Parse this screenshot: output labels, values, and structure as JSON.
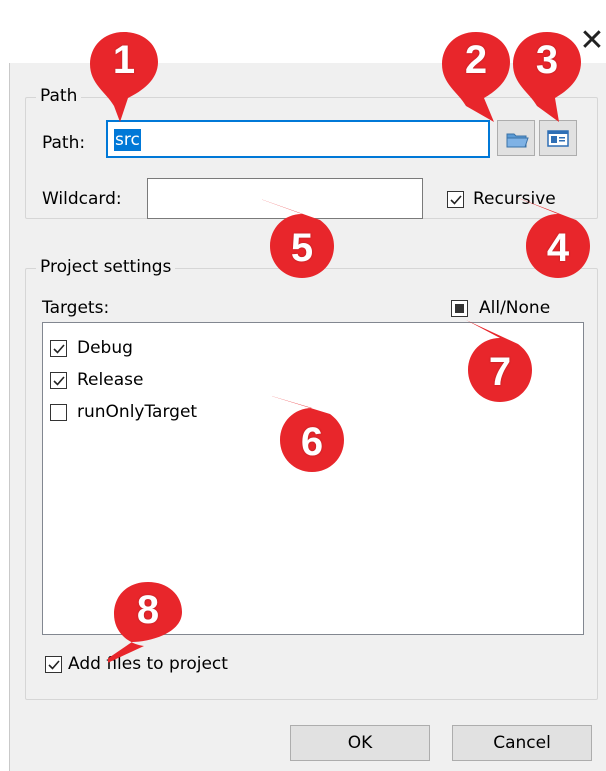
{
  "window": {
    "close_glyph": "✕"
  },
  "path_group": {
    "title": "Path",
    "path_label": "Path:",
    "path_value": "src",
    "wildcard_label": "Wildcard:",
    "wildcard_value": "",
    "recursive_label": "Recursive",
    "recursive_checked": true,
    "browse_icon": "folder-icon",
    "wizard_icon": "window-icon"
  },
  "project_group": {
    "title": "Project settings",
    "targets_label": "Targets:",
    "all_none_label": "All/None",
    "all_none_state": "indeterminate",
    "targets": [
      {
        "label": "Debug",
        "checked": true
      },
      {
        "label": "Release",
        "checked": true
      },
      {
        "label": "runOnlyTarget",
        "checked": false
      }
    ],
    "add_files_label": "Add files to project",
    "add_files_checked": true
  },
  "buttons": {
    "ok": "OK",
    "cancel": "Cancel"
  },
  "annotations": {
    "color": "#e8262b",
    "markers": [
      "1",
      "2",
      "3",
      "4",
      "5",
      "6",
      "7",
      "8"
    ]
  }
}
